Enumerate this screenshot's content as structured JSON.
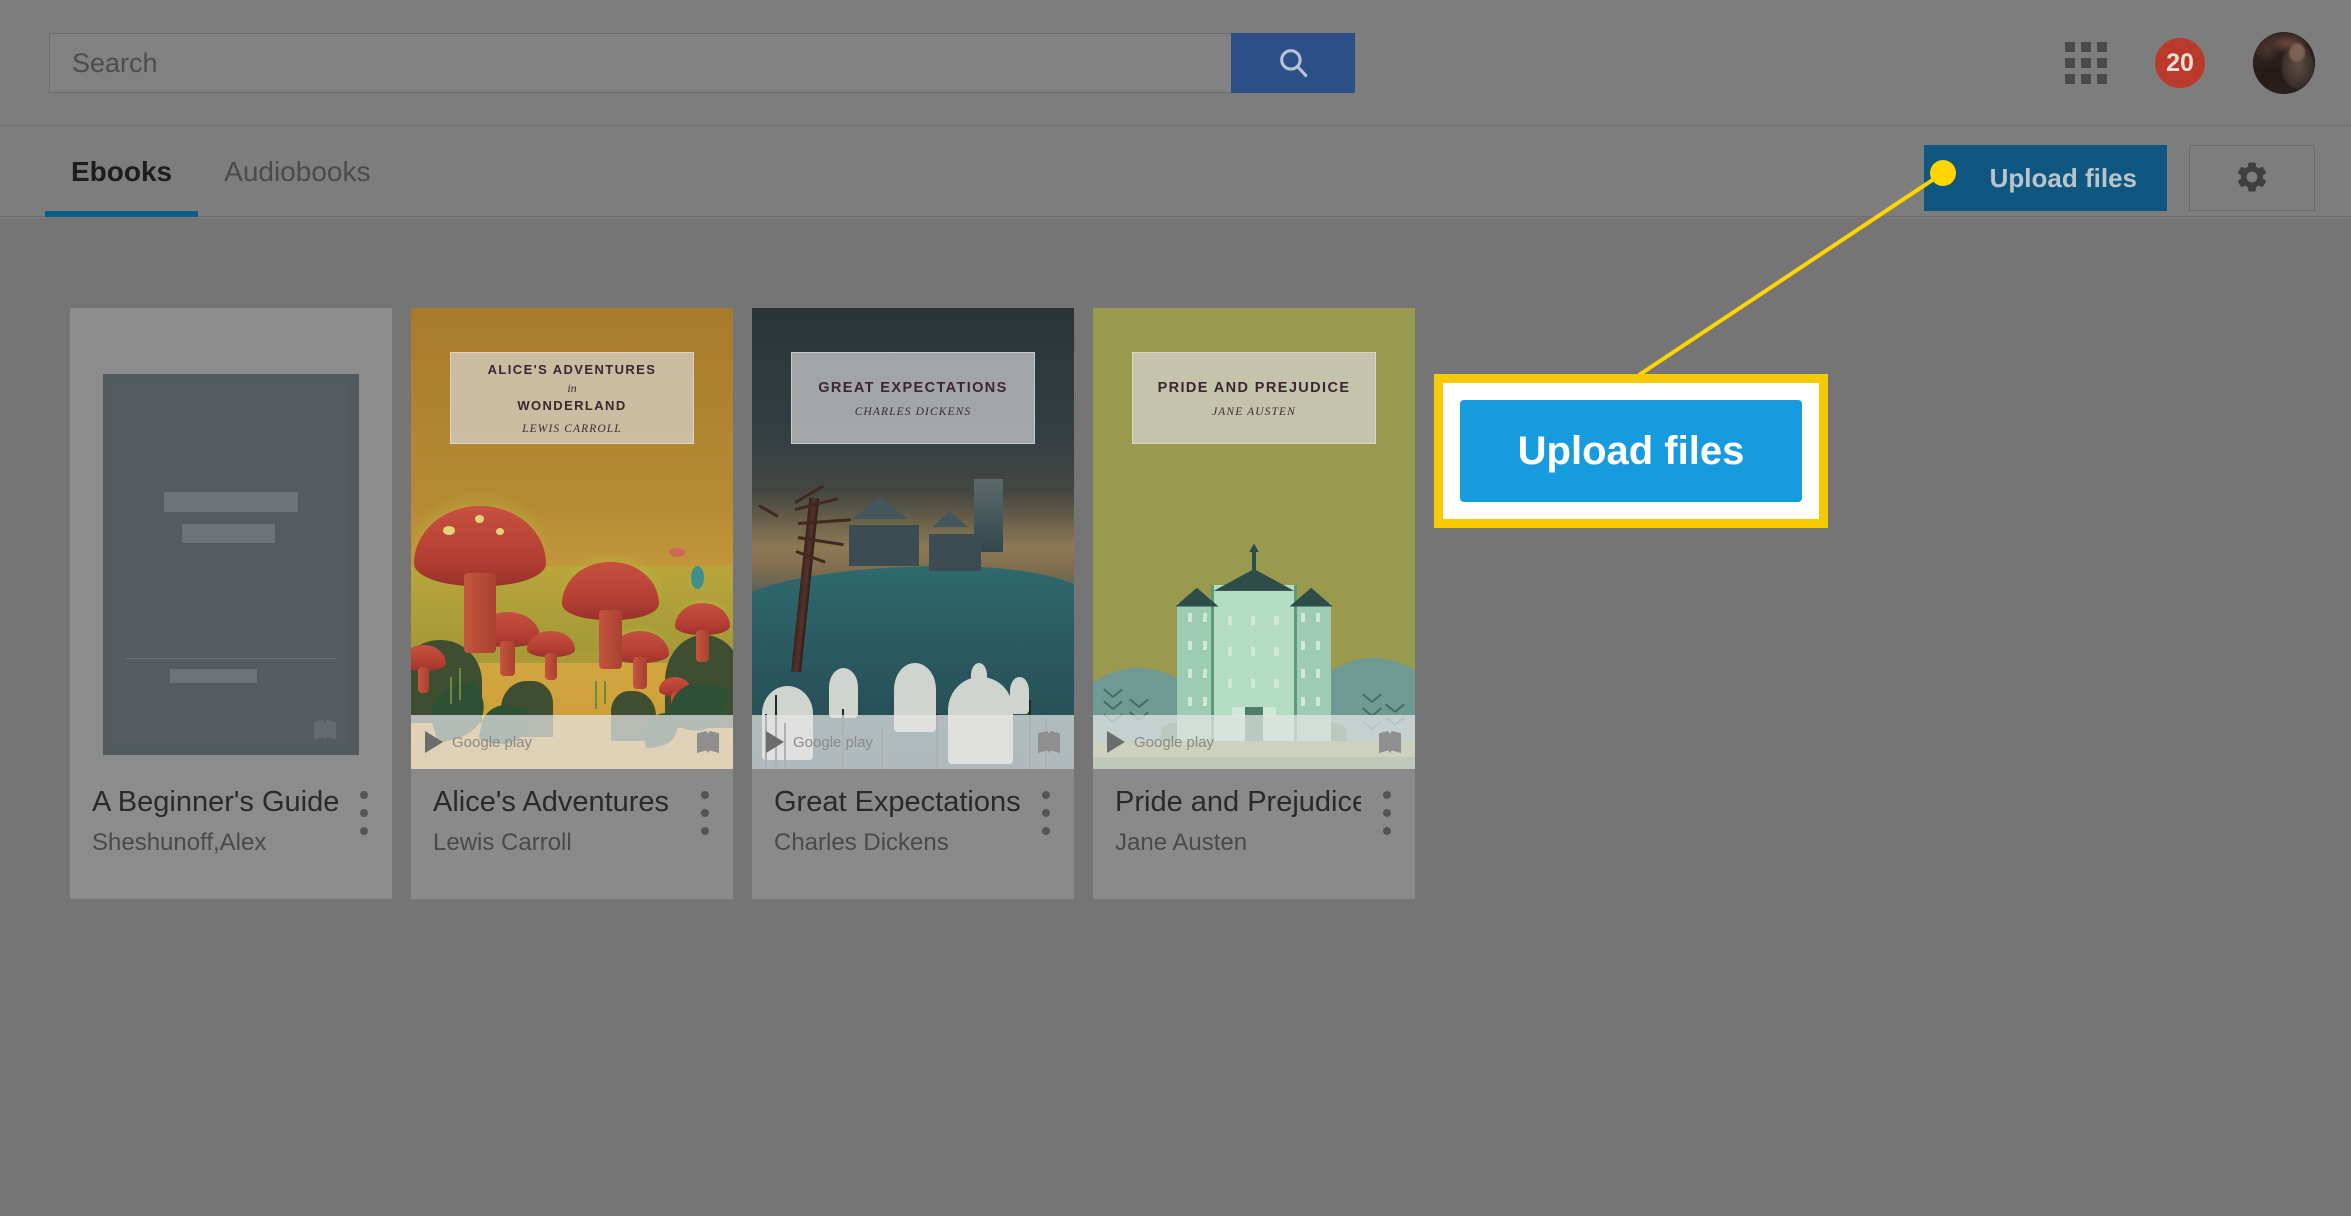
{
  "search": {
    "placeholder": "Search",
    "value": "",
    "button_icon": "search-icon"
  },
  "header": {
    "apps_icon": "apps-grid-icon",
    "notification_count": "20",
    "avatar_label": "account-avatar"
  },
  "tabs": [
    {
      "label": "Ebooks",
      "active": true
    },
    {
      "label": "Audiobooks",
      "active": false
    }
  ],
  "toolbar": {
    "upload_label": "Upload files",
    "settings_icon": "gear-icon"
  },
  "annotation": {
    "callout_label": "Upload files",
    "marker_color": "#ffd400",
    "border_color": "#f7c900",
    "button_color": "#169bdf"
  },
  "books": [
    {
      "title": "A Beginner's Guide",
      "author": "Sheshunoff,Alex",
      "cover_type": "placeholder",
      "has_play_bar": false,
      "cover_title": "",
      "cover_in": "",
      "cover_author": ""
    },
    {
      "title": "Alice's Adventures",
      "author": "Lewis Carroll",
      "cover_type": "alice",
      "has_play_bar": true,
      "cover_title": "ALICE'S ADVENTURES",
      "cover_in": "in",
      "cover_author": "LEWIS CARROLL",
      "play_label": "Google play"
    },
    {
      "title": "Great Expectations",
      "author": "Charles Dickens",
      "cover_type": "great-expectations",
      "has_play_bar": true,
      "cover_title": "GREAT EXPECTATIONS",
      "cover_in": "",
      "cover_author": "CHARLES DICKENS",
      "play_label": "Google play"
    },
    {
      "title": "Pride and Prejudice",
      "author": "Jane Austen",
      "cover_type": "pride-and-prejudice",
      "has_play_bar": true,
      "cover_title": "PRIDE AND PREJUDICE",
      "cover_in": "",
      "cover_author": "JANE AUSTEN",
      "play_label": "Google play"
    }
  ],
  "colors": {
    "accent_blue": "#0d5c8c",
    "search_blue": "#2b4f86",
    "badge_red": "#b93a2b",
    "page_bg": "#757575"
  }
}
